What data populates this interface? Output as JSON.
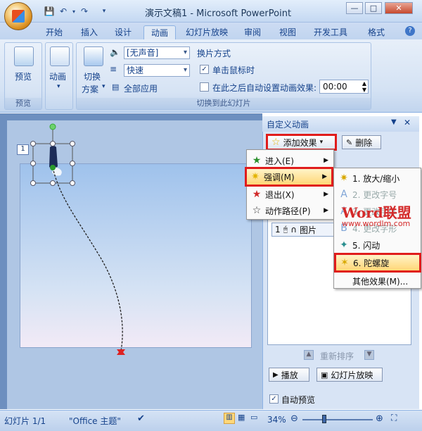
{
  "window": {
    "title": "演示文稿1 - Microsoft PowerPoint"
  },
  "tabs": [
    "开始",
    "插入",
    "设计",
    "动画",
    "幻灯片放映",
    "审阅",
    "视图",
    "开发工具",
    "格式"
  ],
  "active_tab": "动画",
  "ribbon": {
    "preview_button": "预览",
    "preview_group": "预览",
    "animate_button": "动画",
    "transition_scheme_1": "切换",
    "transition_scheme_2": "方案",
    "sound_value": "[无声音]",
    "speed_value": "快速",
    "apply_all": "全部应用",
    "advance_heading": "换片方式",
    "on_click": "单击鼠标时",
    "auto_after": "在此之后自动设置动画效果:",
    "time_value": "00:00",
    "transition_group": "切换到此幻灯片"
  },
  "slide": {
    "number": "1"
  },
  "pane": {
    "title": "自定义动画",
    "add_effect": "添加效果",
    "remove": "删除",
    "list_item_num": "1",
    "list_item_text": "图片",
    "reorder": "重新排序",
    "play": "播放",
    "slideshow": "幻灯片放映",
    "autopreview": "自动预览"
  },
  "menu_effects": [
    {
      "label": "进入(E)",
      "icon": "star-green-icon"
    },
    {
      "label": "强调(M)",
      "icon": "star-yellow-icon"
    },
    {
      "label": "退出(X)",
      "icon": "star-red-icon"
    },
    {
      "label": "动作路径(P)",
      "icon": "star-outline-icon"
    }
  ],
  "menu_emphasis": [
    {
      "label": "1. 放大/缩小",
      "enabled": true
    },
    {
      "label": "2. 更改字号",
      "enabled": false
    },
    {
      "label": "3. 更改字体",
      "enabled": false
    },
    {
      "label": "4. 更改字形",
      "enabled": false
    },
    {
      "label": "5. 闪动",
      "enabled": true
    },
    {
      "label": "6. 陀螺旋",
      "enabled": true
    },
    {
      "label": "其他效果(M)...",
      "enabled": true
    }
  ],
  "watermark": {
    "brand": "Word联盟",
    "url": "www.wordlm.com"
  },
  "statusbar": {
    "slide": "幻灯片 1/1",
    "theme": "\"Office 主题\"",
    "zoom": "34%"
  }
}
